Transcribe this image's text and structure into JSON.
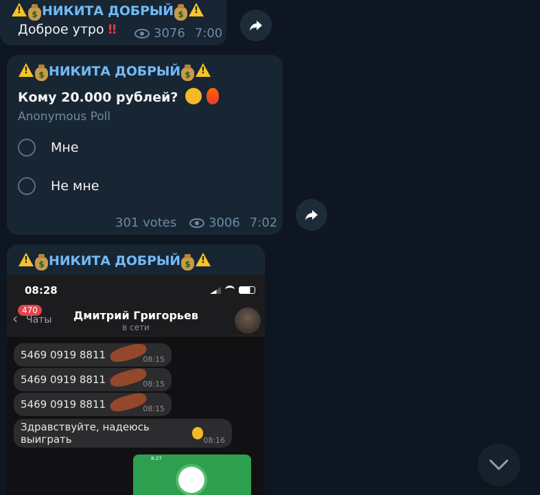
{
  "channel": {
    "sender": "НИКИТА ДОБРЫЙ"
  },
  "messages": [
    {
      "text": "Доброе утро",
      "views": "3076",
      "time": "7:00"
    },
    {
      "question": "Кому 20.000 рублей?",
      "poll_type": "Anonymous Poll",
      "options": [
        "Мне",
        "Не мне"
      ],
      "votes": "301 votes",
      "views": "3006",
      "time": "7:02"
    },
    {
      "screenshot": {
        "time": "08:28",
        "badge": "470",
        "back_label": "Чаты",
        "contact_name": "Дмитрий Григорьев",
        "contact_status": "в сети",
        "bubbles": [
          {
            "text": "5469 0919 8811",
            "time": "08:15"
          },
          {
            "text": "5469 0919 8811",
            "time": "08:15"
          },
          {
            "text": "5469 0919 8811",
            "time": "08:15"
          },
          {
            "text": "Здравствуйте, надеюсь выиграть",
            "time": "08:16"
          }
        ],
        "mini_time": "8:27"
      }
    }
  ],
  "colors": {
    "sender": "#71baf5",
    "bg": "#0e1621",
    "bubble": "#182533"
  },
  "icons": [
    "warning-icon",
    "money-bag-icon",
    "eye-icon",
    "forward-icon",
    "chevron-down-icon"
  ]
}
